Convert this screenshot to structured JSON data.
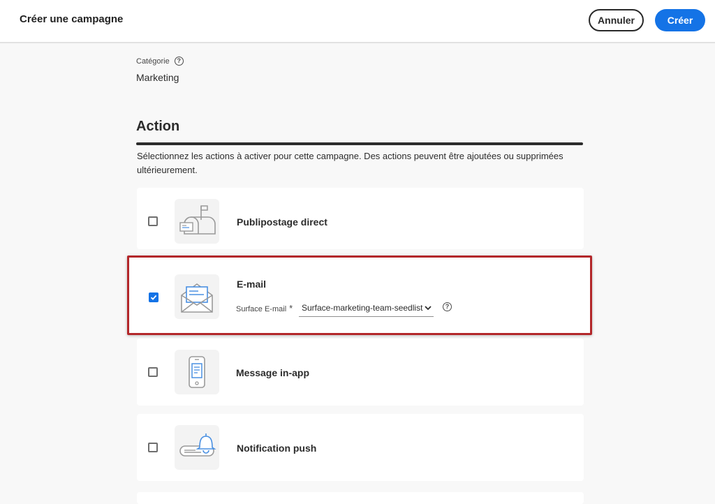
{
  "header": {
    "title": "Créer une campagne",
    "cancel_label": "Annuler",
    "create_label": "Créer"
  },
  "category": {
    "label": "Catégorie",
    "value": "Marketing"
  },
  "action": {
    "title": "Action",
    "description": "Sélectionnez les actions à activer pour cette campagne. Des actions peuvent être ajoutées ou supprimées ultérieurement.",
    "items": [
      {
        "label": "Publipostage direct",
        "checked": false,
        "icon": "mailbox-icon"
      },
      {
        "label": "E-mail",
        "checked": true,
        "icon": "envelope-icon",
        "surface_label": "Surface E-mail",
        "required_mark": "*",
        "surface_value": "Surface-marketing-team-seedlist"
      },
      {
        "label": "Message in-app",
        "checked": false,
        "icon": "mobile-message-icon"
      },
      {
        "label": "Notification push",
        "checked": false,
        "icon": "bell-notification-icon"
      }
    ]
  },
  "colors": {
    "accent": "#1473e6",
    "highlight_border": "#b3272a"
  }
}
